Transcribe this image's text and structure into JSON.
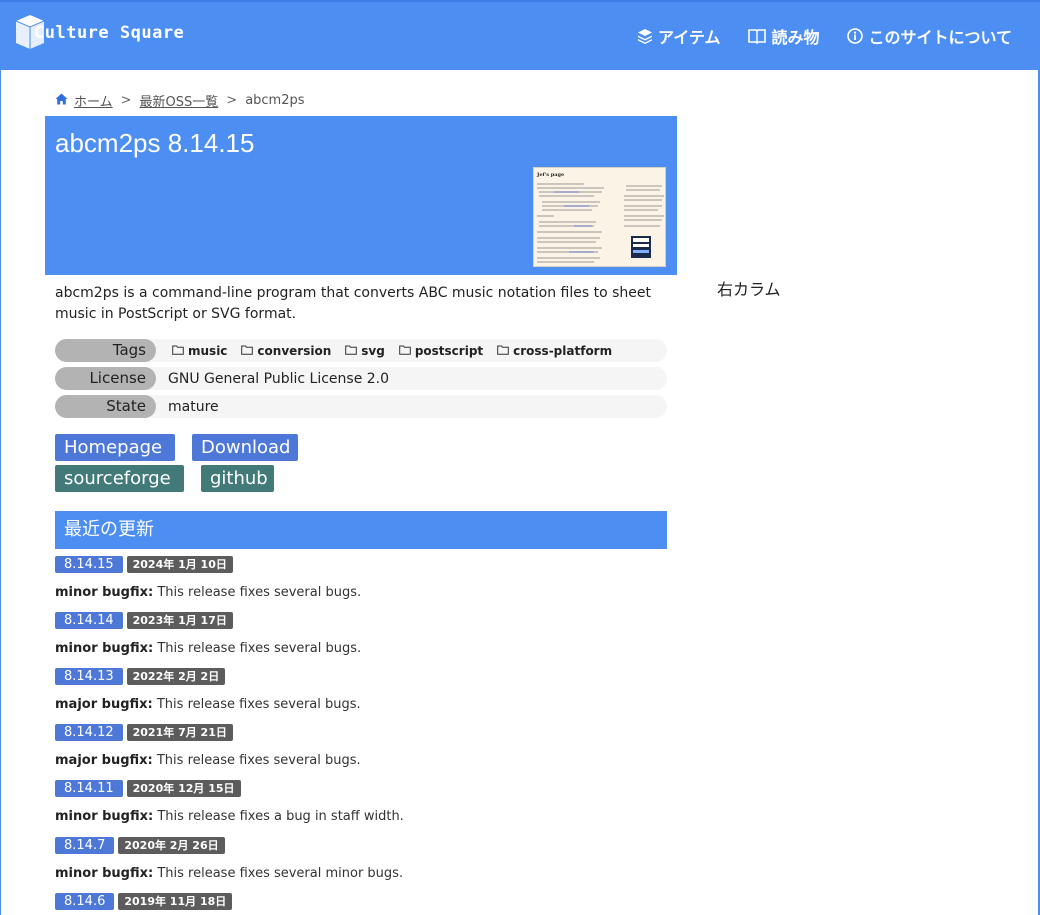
{
  "header": {
    "logo_text": "Culture Square",
    "nav": [
      {
        "label": "アイテム",
        "icon": "layers-icon"
      },
      {
        "label": "読み物",
        "icon": "book-icon"
      },
      {
        "label": "このサイトについて",
        "icon": "info-icon"
      }
    ]
  },
  "breadcrumb": {
    "home": "ホーム",
    "list": "最新OSS一覧",
    "current": "abcm2ps",
    "separator": ">"
  },
  "hero": {
    "title": "abcm2ps 8.14.15",
    "thumb_heading": "Jef's page"
  },
  "summary": "abcm2ps is a command-line program that converts ABC music notation files to sheet music in PostScript or SVG format.",
  "info": {
    "tags_label": "Tags",
    "tags": [
      "music",
      "conversion",
      "svg",
      "postscript",
      "cross-platform"
    ],
    "license_label": "License",
    "license_value": "GNU General Public License 2.0",
    "state_label": "State",
    "state_value": "mature"
  },
  "buttons": {
    "homepage": "Homepage",
    "download": "Download",
    "sourceforge": "sourceforge",
    "github": "github"
  },
  "updates": {
    "title": "最近の更新",
    "items": [
      {
        "version": "8.14.15",
        "date": "2024年 1月 10日",
        "type": "minor bugfix:",
        "text": " This release fixes several bugs."
      },
      {
        "version": "8.14.14",
        "date": "2023年 1月 17日",
        "type": "minor bugfix:",
        "text": " This release fixes several bugs."
      },
      {
        "version": "8.14.13",
        "date": "2022年 2月 2日",
        "type": "major bugfix:",
        "text": " This release fixes several bugs."
      },
      {
        "version": "8.14.12",
        "date": "2021年 7月 21日",
        "type": "major bugfix:",
        "text": " This release fixes several bugs."
      },
      {
        "version": "8.14.11",
        "date": "2020年 12月 15日",
        "type": "minor bugfix:",
        "text": " This release fixes a bug in staff width."
      },
      {
        "version": "8.14.7",
        "date": "2020年 2月 26日",
        "type": "minor bugfix:",
        "text": " This release fixes several minor bugs."
      },
      {
        "version": "8.14.6",
        "date": "2019年 11月 18日"
      }
    ]
  },
  "right_column": "右カラム",
  "colors": {
    "brand_blue": "#4d8ef2",
    "button_blue": "#4d78d8",
    "button_teal": "#417a78"
  }
}
